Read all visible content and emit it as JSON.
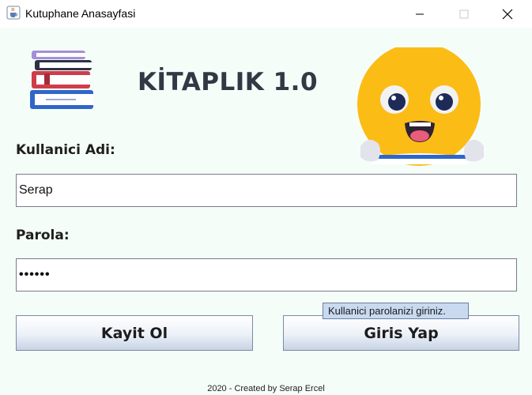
{
  "window": {
    "title": "Kutuphane Anasayfasi",
    "icon": "java-cup-icon"
  },
  "header": {
    "title": "KİTAPLIK 1.0",
    "books_icon": "books-stack-icon",
    "mascot_icon": "smiley-reading-icon"
  },
  "form": {
    "username_label": "Kullanici Adi:",
    "username_value": "Serap",
    "password_label": "Parola:",
    "password_value": "••••••"
  },
  "buttons": {
    "register_label": "Kayit Ol",
    "login_label": "Giris Yap"
  },
  "tooltip": {
    "text": "Kullanici parolanizi giriniz."
  },
  "footer": {
    "text": "2020 - Created by Serap Ercel"
  },
  "colors": {
    "background": "#f5fdf8",
    "heading": "#333845",
    "smiley": "#fbbc16",
    "tooltip_bg": "#c9d9f0"
  }
}
